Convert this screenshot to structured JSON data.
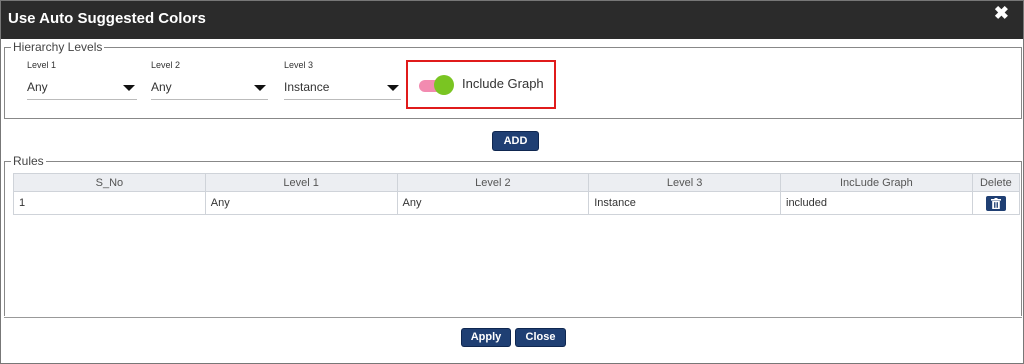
{
  "dialog": {
    "title": "Use Auto Suggested Colors",
    "close_glyph": "✖"
  },
  "hierarchy": {
    "legend": "Hierarchy Levels",
    "levels": [
      {
        "label": "Level 1",
        "value": "Any"
      },
      {
        "label": "Level 2",
        "value": "Any"
      },
      {
        "label": "Level 3",
        "value": "Instance"
      }
    ],
    "include_graph": {
      "label": "Include Graph",
      "on": true
    },
    "add_label": "ADD"
  },
  "rules": {
    "legend": "Rules",
    "columns": [
      "S_No",
      "Level 1",
      "Level 2",
      "Level 3",
      "IncLude Graph",
      "Delete"
    ],
    "rows": [
      {
        "s_no": "1",
        "level1": "Any",
        "level2": "Any",
        "level3": "Instance",
        "include_graph": "included",
        "delete_icon": "trash-icon"
      }
    ]
  },
  "footer": {
    "apply_label": "Apply",
    "close_label": "Close"
  },
  "colors": {
    "titlebar": "#2b2b2b",
    "button": "#1f3f73",
    "toggle_track": "#f28bb0",
    "toggle_knob": "#7ac522",
    "highlight": "#e01b1b"
  }
}
